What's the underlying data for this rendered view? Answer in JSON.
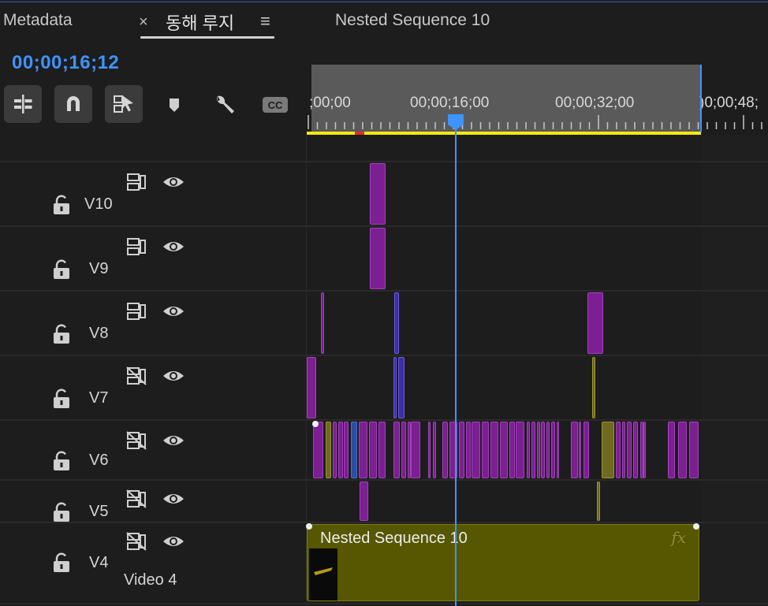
{
  "tabs": {
    "metadata": "Metadata",
    "close": "×",
    "active": "동해 루지",
    "menu": "≡",
    "nested": "Nested Sequence 10"
  },
  "timecode": "00;00;16;12",
  "toolbar": {
    "items": [
      {
        "name": "insert-edit-icon",
        "active": true
      },
      {
        "name": "snap-magnet-icon",
        "active": true
      },
      {
        "name": "linked-selection-icon",
        "active": true
      },
      {
        "name": "add-marker-icon",
        "active": false
      },
      {
        "name": "settings-wrench-icon",
        "active": false
      },
      {
        "name": "captions-cc-icon",
        "active": false
      }
    ],
    "cc_label": "CC"
  },
  "ruler": {
    "labels": [
      ";00;00",
      "00;00;16;00",
      "00;00;32;00",
      ")0;00;48;"
    ]
  },
  "tracks": [
    {
      "name": "V10",
      "sync": true
    },
    {
      "name": "V9",
      "sync": true
    },
    {
      "name": "V8",
      "sync": true
    },
    {
      "name": "V7",
      "sync": false
    },
    {
      "name": "V6",
      "sync": false
    },
    {
      "name": "V5",
      "sync": false
    },
    {
      "name": "V4",
      "sync": false,
      "label": "Video 4"
    }
  ],
  "nested_clip": {
    "label": "Nested Sequence 10",
    "fx": "fx"
  },
  "colors": {
    "accent": "#3e93ff",
    "clip_purple": "#7b1f93",
    "clip_blue": "#3b2fa8",
    "clip_olive": "#6e6a20",
    "nested_clip": "#565700",
    "work_area": "#f3ea12"
  }
}
